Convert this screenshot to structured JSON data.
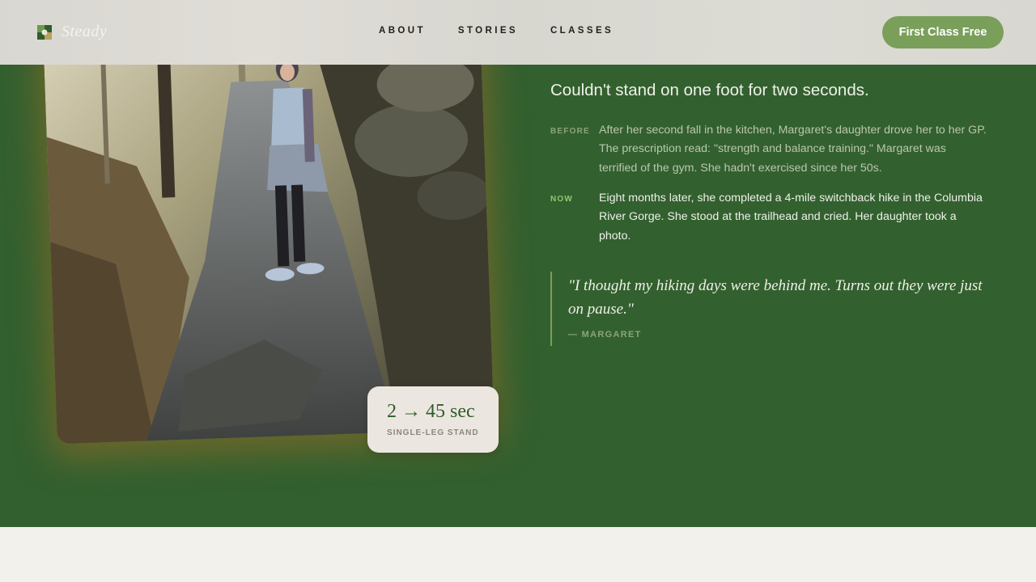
{
  "header": {
    "logo_text": "Steady",
    "nav": [
      "ABOUT",
      "STORIES",
      "CLASSES"
    ],
    "cta_label": "First Class Free"
  },
  "story": {
    "headline": "Couldn't stand on one foot for two seconds.",
    "before_label": "BEFORE",
    "before_text": "After her second fall in the kitchen, Margaret's daughter drove her to her GP. The prescription read: \"strength and balance training.\" Margaret was terrified of the gym. She hadn't exercised since her 50s.",
    "now_label": "NOW",
    "now_text": "Eight months later, she completed a 4-mile switchback hike in the Columbia River Gorge. She stood at the trailhead and cried. Her daughter took a photo.",
    "quote": "\"I thought my hiking days were behind me. Turns out they were just on pause.\"",
    "quote_author": "— MARGARET"
  },
  "stat": {
    "value": "2 → 45 sec",
    "label": "SINGLE-LEG STAND"
  },
  "colors": {
    "section_bg": "#33602f",
    "accent": "#7a9f5a",
    "page_bg": "#f3f1ec"
  },
  "icons": {
    "logo": "steady-leaf-icon"
  }
}
